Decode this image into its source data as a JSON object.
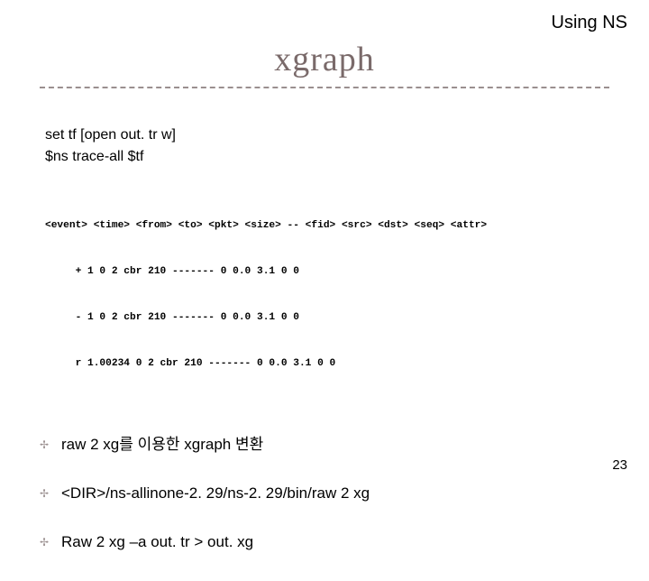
{
  "header": {
    "right": "Using NS"
  },
  "title": "xgraph",
  "commands": {
    "line1": "set tf [open out. tr w]",
    "line2": "$ns trace-all $tf"
  },
  "trace": {
    "row1": "<event> <time> <from> <to> <pkt> <size> -- <fid> <src> <dst> <seq> <attr>",
    "row2": "     + 1 0 2 cbr 210 ------- 0 0.0 3.1 0 0",
    "row3": "     - 1 0 2 cbr 210 ------- 0 0.0 3.1 0 0",
    "row4": "     r 1.00234 0 2 cbr 210 ------- 0 0.0 3.1 0 0"
  },
  "bullets": {
    "mark": "✢",
    "items": [
      "raw 2 xg를 이용한 xgraph 변환",
      "<DIR>/ns-allinone-2. 29/ns-2. 29/bin/raw 2 xg",
      "Raw 2 xg –a out. tr > out. xg"
    ]
  },
  "page_number": "23"
}
